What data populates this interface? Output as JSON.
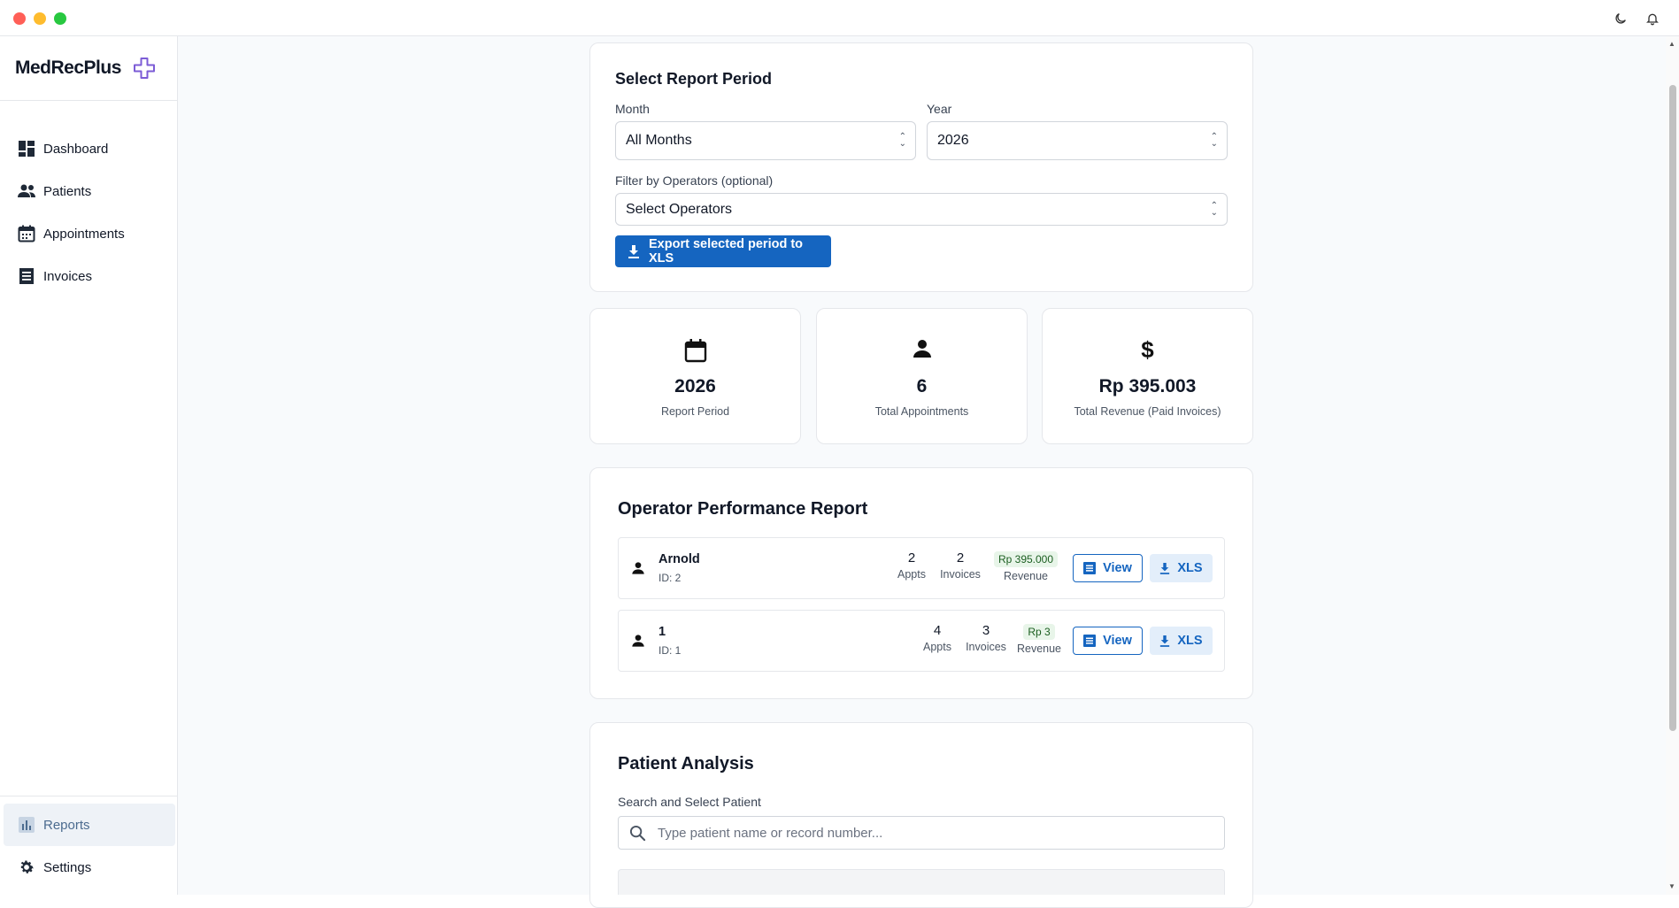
{
  "app": {
    "name": "MedRecPlus"
  },
  "sidebar": {
    "items": [
      {
        "label": "Dashboard",
        "icon": "dashboard-icon"
      },
      {
        "label": "Patients",
        "icon": "people-icon"
      },
      {
        "label": "Appointments",
        "icon": "calendar-icon"
      },
      {
        "label": "Invoices",
        "icon": "invoice-icon"
      }
    ],
    "bottom_items": [
      {
        "label": "Reports",
        "icon": "bar-chart-icon",
        "active": true
      },
      {
        "label": "Settings",
        "icon": "gear-icon"
      }
    ]
  },
  "period": {
    "title": "Select Report Period",
    "month_label": "Month",
    "month_value": "All Months",
    "year_label": "Year",
    "year_value": "2026",
    "operators_label": "Filter by Operators (optional)",
    "operators_value": "Select Operators",
    "export_label": "Export selected period to XLS"
  },
  "stats": [
    {
      "icon": "calendar-icon",
      "value": "2026",
      "label": "Report Period"
    },
    {
      "icon": "person-icon",
      "value": "6",
      "label": "Total Appointments"
    },
    {
      "icon": "dollar-icon",
      "value": "Rp 395.003",
      "label": "Total Revenue (Paid Invoices)"
    }
  ],
  "operators": {
    "title": "Operator Performance Report",
    "appts_caption": "Appts",
    "invoices_caption": "Invoices",
    "revenue_caption": "Revenue",
    "view_label": "View",
    "xls_label": "XLS",
    "rows": [
      {
        "name": "Arnold",
        "id": "ID: 2",
        "appts": "2",
        "invoices": "2",
        "revenue": "Rp 395.000"
      },
      {
        "name": "1",
        "id": "ID: 1",
        "appts": "4",
        "invoices": "3",
        "revenue": "Rp 3"
      }
    ]
  },
  "patient_analysis": {
    "title": "Patient Analysis",
    "search_label": "Search and Select Patient",
    "search_placeholder": "Type patient name or record number..."
  },
  "colors": {
    "primary": "#1565c0",
    "logo_accent": "#7c5cd6",
    "active_nav_bg": "#eef2f7",
    "revenue_badge_bg": "#e8f5e9"
  }
}
